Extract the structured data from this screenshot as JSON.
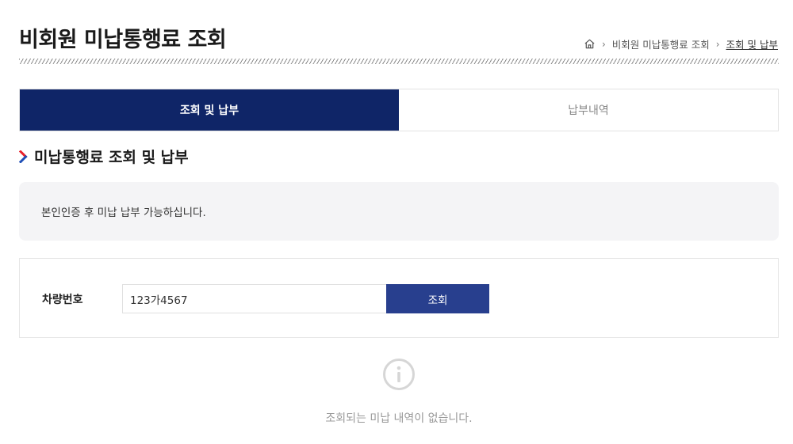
{
  "header": {
    "title": "비회원 미납통행료 조회",
    "breadcrumb": {
      "home_icon": "home-icon",
      "level1": "비회원 미납통행료 조회",
      "current": "조회 및 납부"
    }
  },
  "tabs": [
    {
      "label": "조회 및 납부",
      "active": true
    },
    {
      "label": "납부내역",
      "active": false
    }
  ],
  "section": {
    "title": "미납통행료 조회 및 납부"
  },
  "notice": {
    "text": "본인인증 후 미납 납부 가능하십니다."
  },
  "form": {
    "vehicle_label": "차량번호",
    "vehicle_value": "123가4567",
    "search_label": "조회"
  },
  "empty_state": {
    "icon": "info-icon",
    "message": "조회되는 미납 내역이 없습니다."
  },
  "colors": {
    "tab_active": "#0f2567",
    "button": "#283f8e",
    "accent_red": "#e8202a",
    "accent_blue": "#1f4fb6"
  }
}
